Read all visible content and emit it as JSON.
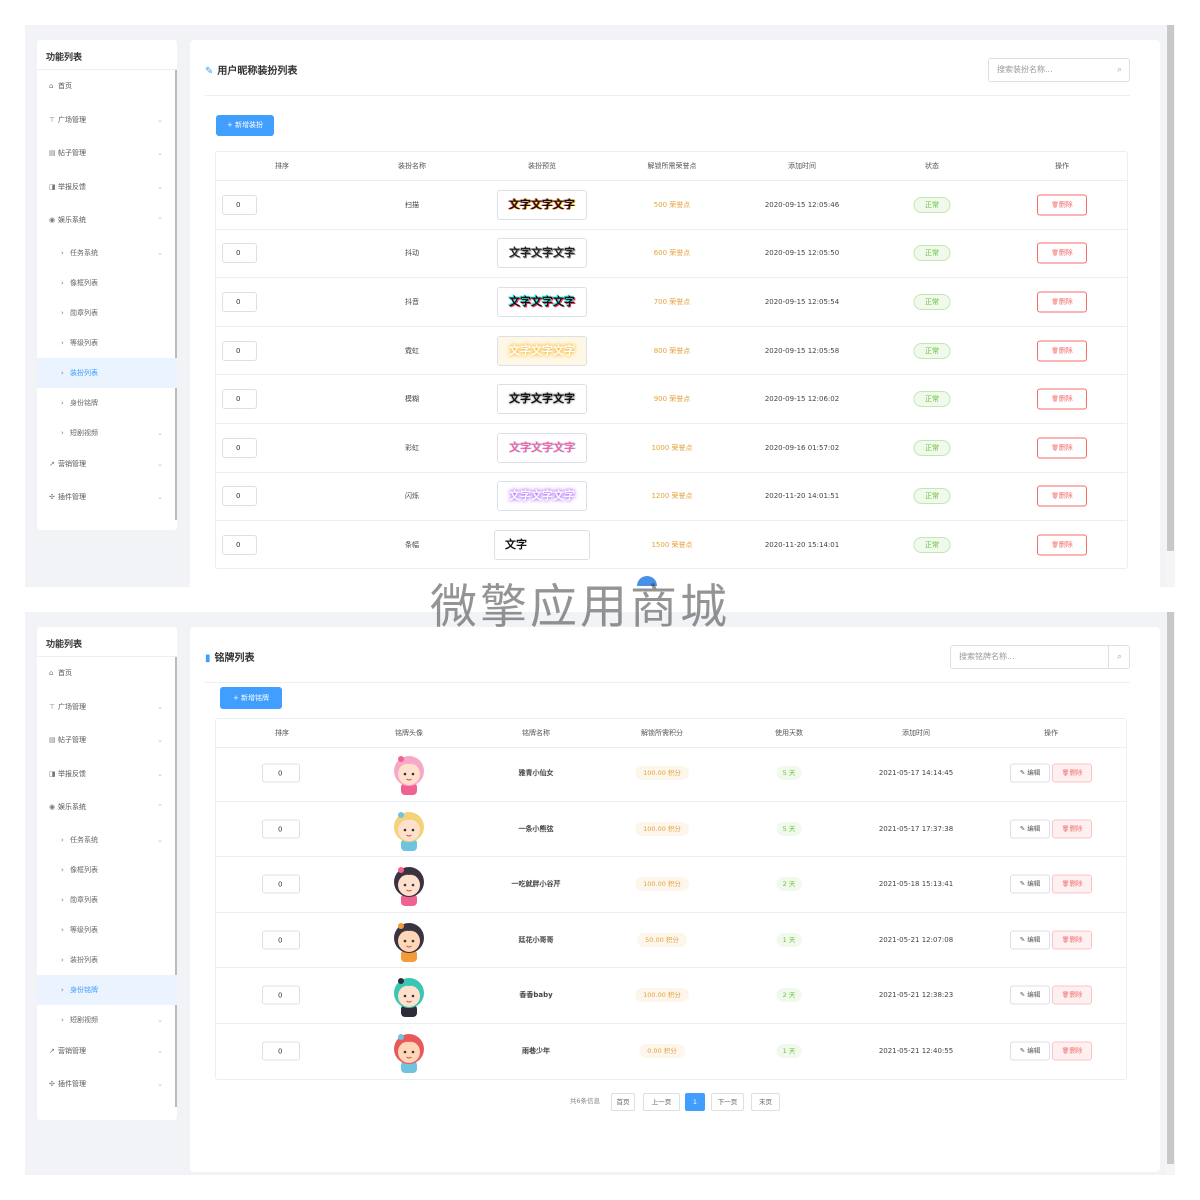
{
  "sidebar": {
    "title": "功能列表",
    "items": [
      {
        "label": "首页",
        "icon": "home-icon",
        "glyph": "⌂",
        "sub": false,
        "arrow": ""
      },
      {
        "label": "广场管理",
        "icon": "square-icon",
        "glyph": "⊤",
        "sub": false,
        "arrow": "⌄"
      },
      {
        "label": "帖子管理",
        "icon": "file-icon",
        "glyph": "▤",
        "sub": false,
        "arrow": "⌄"
      },
      {
        "label": "举报反馈",
        "icon": "shield-icon",
        "glyph": "◨",
        "sub": false,
        "arrow": "⌄"
      },
      {
        "label": "娱乐系统",
        "icon": "game-icon",
        "glyph": "◉",
        "sub": false,
        "arrow": "⌃"
      },
      {
        "label": "任务系统",
        "icon": "chevron-right-icon",
        "glyph": "›",
        "sub": true,
        "arrow": "⌄"
      },
      {
        "label": "像框列表",
        "icon": "chevron-right-icon",
        "glyph": "›",
        "sub": true,
        "arrow": ""
      },
      {
        "label": "勋章列表",
        "icon": "chevron-right-icon",
        "glyph": "›",
        "sub": true,
        "arrow": ""
      },
      {
        "label": "等级列表",
        "icon": "chevron-right-icon",
        "glyph": "›",
        "sub": true,
        "arrow": ""
      },
      {
        "label": "装扮列表",
        "icon": "chevron-right-icon",
        "glyph": "›",
        "sub": true,
        "arrow": ""
      },
      {
        "label": "身份铭牌",
        "icon": "chevron-right-icon",
        "glyph": "›",
        "sub": true,
        "arrow": ""
      },
      {
        "label": "短剧视频",
        "icon": "chevron-right-icon",
        "glyph": "›",
        "sub": true,
        "arrow": "⌄"
      },
      {
        "label": "营销管理",
        "icon": "marketing-icon",
        "glyph": "↗",
        "sub": false,
        "arrow": "⌄"
      },
      {
        "label": "插件管理",
        "icon": "plugin-icon",
        "glyph": "✣",
        "sub": false,
        "arrow": "⌄"
      }
    ]
  },
  "panel1": {
    "active_index": 9,
    "title": "用户昵称装扮列表",
    "search_placeholder": "搜索装扮名称...",
    "add_label": "新增装扮",
    "columns": [
      "排序",
      "装扮名称",
      "装扮预览",
      "解锁所需荣誉点",
      "添加时间",
      "状态",
      "操作"
    ],
    "delete_label": "删除",
    "rows": [
      {
        "sort": "0",
        "name": "扫描",
        "preview": "文字文字文字",
        "points": "500 荣誉点",
        "time": "2020-09-15 12:05:46",
        "status": "正常"
      },
      {
        "sort": "0",
        "name": "抖动",
        "preview": "文字文字文字",
        "points": "600 荣誉点",
        "time": "2020-09-15 12:05:50",
        "status": "正常"
      },
      {
        "sort": "0",
        "name": "抖音",
        "preview": "文字文字文字",
        "points": "700 荣誉点",
        "time": "2020-09-15 12:05:54",
        "status": "正常"
      },
      {
        "sort": "0",
        "name": "霓虹",
        "preview": "文字文字文字",
        "points": "800 荣誉点",
        "time": "2020-09-15 12:05:58",
        "status": "正常"
      },
      {
        "sort": "0",
        "name": "模糊",
        "preview": "文字文字文字",
        "points": "900 荣誉点",
        "time": "2020-09-15 12:06:02",
        "status": "正常"
      },
      {
        "sort": "0",
        "name": "彩虹",
        "preview": "文字文字文字",
        "points": "1000 荣誉点",
        "time": "2020-09-16 01:57:02",
        "status": "正常"
      },
      {
        "sort": "0",
        "name": "闪烁",
        "preview": "文字文字文字",
        "points": "1200 荣誉点",
        "time": "2020-11-20 14:01:51",
        "status": "正常"
      },
      {
        "sort": "0",
        "name": "条幅",
        "preview": "文字",
        "points": "1500 荣誉点",
        "time": "2020-11-20 15:14:01",
        "status": "正常"
      }
    ]
  },
  "panel2": {
    "active_index": 10,
    "title": "铭牌列表",
    "search_placeholder": "搜索铭牌名称...",
    "add_label": "新增铭牌",
    "columns": [
      "排序",
      "铭牌头像",
      "铭牌名称",
      "解锁所需积分",
      "使用天数",
      "添加时间",
      "操作"
    ],
    "edit_label": "编辑",
    "delete_label": "删除",
    "rows": [
      {
        "sort": "0",
        "name": "雅青小仙女",
        "points": "100.00 积分",
        "days": "5 天",
        "time": "2021-05-17 14:14:45",
        "hair": "#f7a8c8",
        "skin": "#ffe0cc",
        "acc": "#f06292"
      },
      {
        "sort": "0",
        "name": "一条小熊弦",
        "points": "100.00 积分",
        "days": "5 天",
        "time": "2021-05-17 17:37:38",
        "hair": "#f3d27a",
        "skin": "#ffe0cc",
        "acc": "#6fc3df"
      },
      {
        "sort": "0",
        "name": "一吃就胖小谷芹",
        "points": "100.00 积分",
        "days": "2 天",
        "time": "2021-05-18 15:13:41",
        "hair": "#3a3340",
        "skin": "#ffe0cc",
        "acc": "#f06292"
      },
      {
        "sort": "0",
        "name": "廷花小哥哥",
        "points": "50.00 积分",
        "days": "1 天",
        "time": "2021-05-21 12:07:08",
        "hair": "#3a3340",
        "skin": "#ffd7b8",
        "acc": "#f29b38"
      },
      {
        "sort": "0",
        "name": "香香baby",
        "points": "100.00 积分",
        "days": "2 天",
        "time": "2021-05-21 12:38:23",
        "hair": "#38c6b5",
        "skin": "#ffe0cc",
        "acc": "#2d2d3a"
      },
      {
        "sort": "0",
        "name": "雨巷少年",
        "points": "0.00 积分",
        "days": "1 天",
        "time": "2021-05-21 12:40:55",
        "hair": "#e85a5a",
        "skin": "#ffd7b8",
        "acc": "#6fc3df"
      }
    ],
    "pager": {
      "info": "共6条信息",
      "first": "首页",
      "prev": "上一页",
      "current": "1",
      "next": "下一页",
      "last": "末页"
    }
  },
  "watermark": "微擎应用商城",
  "colors": {
    "accent": "#409eff",
    "success": "#67c23a",
    "danger": "#f56c6c",
    "warning": "#e6a23c"
  }
}
